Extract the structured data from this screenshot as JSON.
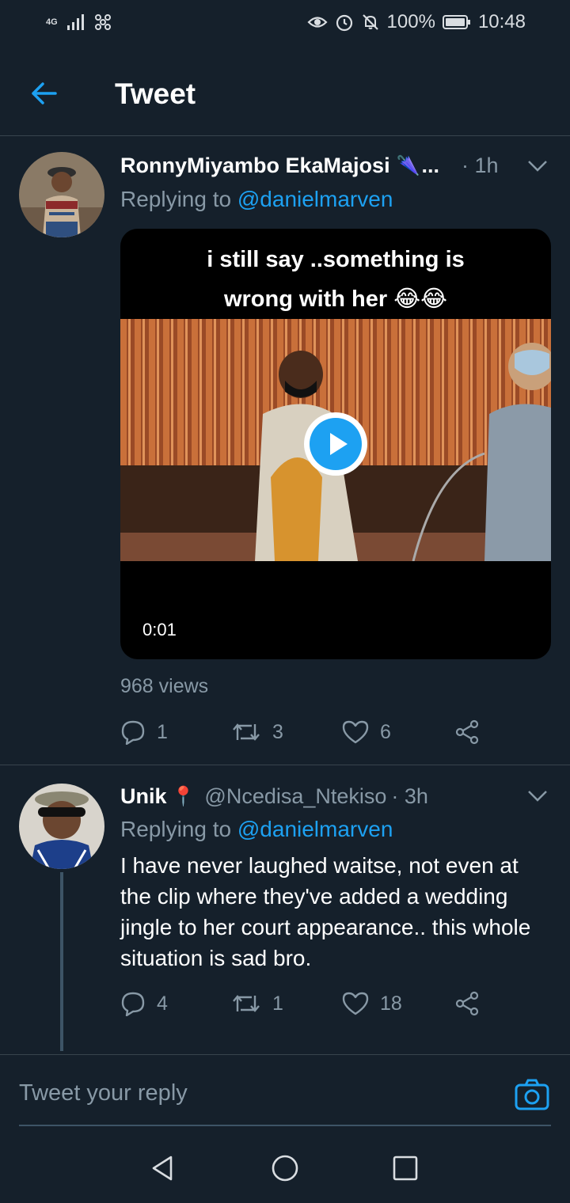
{
  "status_bar": {
    "network": "4G",
    "battery": "100%",
    "time": "10:48",
    "icons": [
      "signal-icon",
      "hotspot-icon",
      "eye-icon",
      "alarm-icon",
      "mute-icon",
      "battery-icon"
    ]
  },
  "header": {
    "title": "Tweet",
    "back_icon": "back-arrow-icon"
  },
  "tweets": [
    {
      "display_name": "RonnyMiyambo EkaMajosi",
      "name_emoji": "🌂",
      "truncation": "...",
      "time": "· 1h",
      "replying_label": "Replying to",
      "replying_handle": "@danielmarven",
      "media": {
        "caption_line1": "i still say ..something is",
        "caption_line2": "wrong with her 😂😂",
        "duration": "0:01"
      },
      "views": "968 views",
      "reply_count": "1",
      "retweet_count": "3",
      "like_count": "6"
    },
    {
      "display_name": "Unik",
      "name_emoji": "📍",
      "handle": "@Ncedisa_Ntekiso",
      "time": "· 3h",
      "replying_label": "Replying to",
      "replying_handle": "@danielmarven",
      "text": "I have never laughed waitse, not even at the clip where they've added a wedding jingle to her court appearance.. this whole situation is sad bro.",
      "reply_count": "4",
      "retweet_count": "1",
      "like_count": "18"
    }
  ],
  "reply_bar": {
    "placeholder": "Tweet your reply",
    "camera_icon": "camera-icon"
  },
  "nav_bar": {
    "icons": [
      "back-triangle-icon",
      "home-circle-icon",
      "recents-square-icon"
    ]
  },
  "colors": {
    "background": "#15202b",
    "accent": "#1da1f2",
    "secondary_text": "#8899a6",
    "border": "#38444d"
  }
}
